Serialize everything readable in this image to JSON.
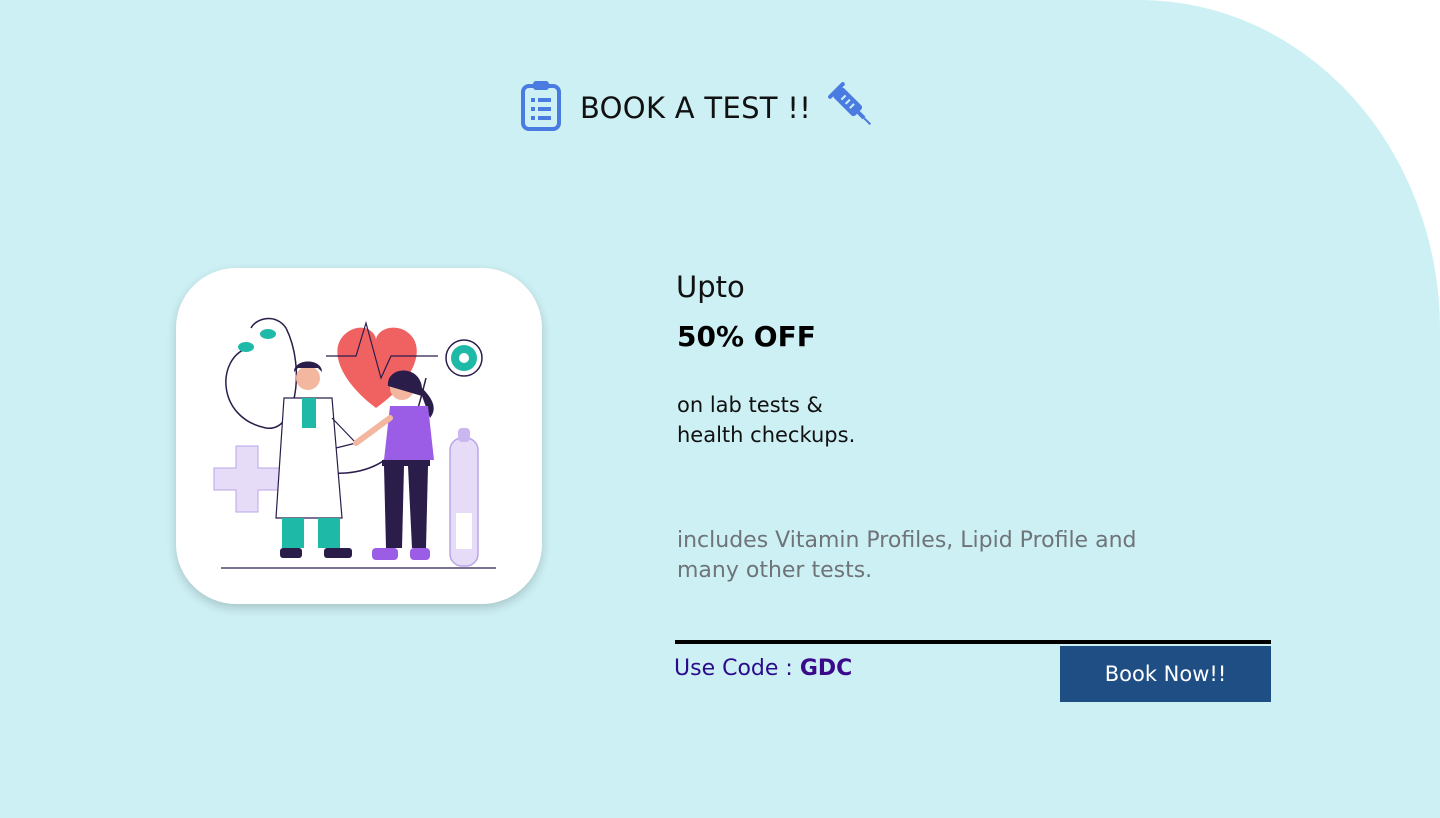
{
  "header": {
    "title": "BOOK A TEST !!",
    "left_icon": "clipboard-icon",
    "right_icon": "syringe-icon"
  },
  "offer": {
    "prefix": "Upto",
    "discount": "50% OFF",
    "subtext_line1": "on lab tests &",
    "subtext_line2": "health checkups.",
    "description": "includes Vitamin Profiles, Lipid Profile and many other tests.",
    "code_label": "Use Code : ",
    "code_value": "GDC",
    "cta_label": "Book Now!!"
  },
  "colors": {
    "background": "#cdf0f4",
    "button": "#1f4e85",
    "code": "#3a0a8a",
    "accent_icon": "#4a7be0"
  }
}
